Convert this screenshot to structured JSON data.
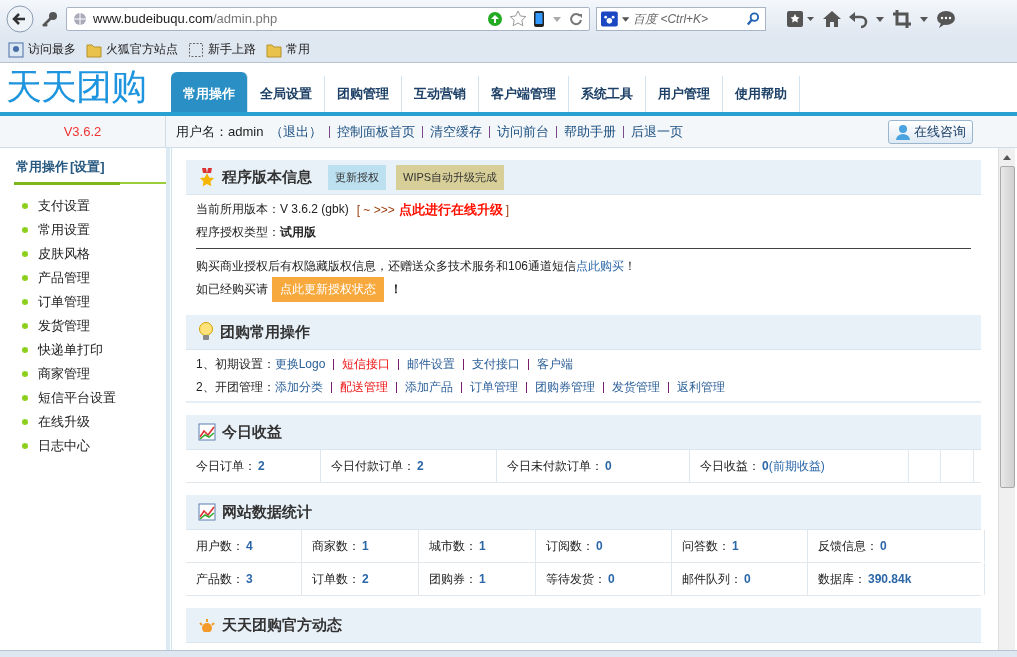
{
  "browser": {
    "url_host": "www.budeibuqu.com",
    "url_path": "/admin.php",
    "search_placeholder": "百度 <Ctrl+K>",
    "bookmarks": [
      {
        "label": "访问最多",
        "kind": "special"
      },
      {
        "label": "火狐官方站点",
        "kind": "folder"
      },
      {
        "label": "新手上路",
        "kind": "page"
      },
      {
        "label": "常用",
        "kind": "folder"
      }
    ]
  },
  "header": {
    "logo": "天天团购",
    "tabs": [
      {
        "label": "常用操作",
        "selected": true
      },
      {
        "label": "全局设置",
        "selected": false
      },
      {
        "label": "团购管理",
        "selected": false
      },
      {
        "label": "互动营销",
        "selected": false
      },
      {
        "label": "客户端管理",
        "selected": false
      },
      {
        "label": "系统工具",
        "selected": false
      },
      {
        "label": "用户管理",
        "selected": false
      },
      {
        "label": "使用帮助",
        "selected": false
      }
    ]
  },
  "subbar": {
    "version": "V3.6.2",
    "user_label": "用户名：",
    "username": "admin",
    "logout": "（退出）",
    "links": [
      "控制面板首页",
      "清空缓存",
      "访问前台",
      "帮助手册",
      "后退一页"
    ],
    "consult_button": "在线咨询"
  },
  "sidebar": {
    "title": "常用操作",
    "title_link": "[设置]",
    "items": [
      "支付设置",
      "常用设置",
      "皮肤风格",
      "产品管理",
      "订单管理",
      "发货管理",
      "快递单打印",
      "商家管理",
      "短信平台设置",
      "在线升级",
      "日志中心"
    ]
  },
  "version_panel": {
    "title": "程序版本信息",
    "buttons": [
      {
        "label": "更新授权",
        "kind": "blue"
      },
      {
        "label": "WIPS自动升级完成",
        "kind": "tan"
      }
    ],
    "current_label": "当前所用版本：",
    "current_value": "V 3.6.2 (gbk)",
    "upgrade_prefix": "[ ~ >>>",
    "upgrade_link": "点此进行在线升级",
    "upgrade_suffix": "]",
    "license_label": "程序授权类型：",
    "license_value": "试用版",
    "promo_text": "购买商业授权后有权隐藏版权信息，还赠送众多技术服务和106通道短信",
    "promo_link": "点此购买",
    "promo_end": "！",
    "renew_prefix": "如已经购买请",
    "renew_button": "点此更新授权状态",
    "renew_end": "！"
  },
  "ops_panel": {
    "title": "团购常用操作",
    "rows": [
      {
        "label": "1、初期设置：",
        "links": [
          {
            "label": "更换Logo",
            "highlight": false
          },
          {
            "label": "短信接口",
            "highlight": true
          },
          {
            "label": "邮件设置",
            "highlight": false
          },
          {
            "label": "支付接口",
            "highlight": false
          },
          {
            "label": "客户端",
            "highlight": false
          }
        ]
      },
      {
        "label": "2、开团管理：",
        "links": [
          {
            "label": "添加分类",
            "highlight": false
          },
          {
            "label": "配送管理",
            "highlight": true
          },
          {
            "label": "添加产品",
            "highlight": false
          },
          {
            "label": "订单管理",
            "highlight": false
          },
          {
            "label": "团购券管理",
            "highlight": false
          },
          {
            "label": "发货管理",
            "highlight": false
          },
          {
            "label": "返利管理",
            "highlight": false
          }
        ]
      }
    ]
  },
  "income_panel": {
    "title": "今日收益",
    "stats": [
      {
        "label": "今日订单：",
        "value": "2"
      },
      {
        "label": "今日付款订单：",
        "value": "2"
      },
      {
        "label": "今日未付款订单：",
        "value": "0"
      },
      {
        "label": "今日收益：",
        "value": "0",
        "link": "(前期收益)"
      }
    ]
  },
  "site_panel": {
    "title": "网站数据统计",
    "rows": [
      [
        {
          "label": "用户数：",
          "value": "4"
        },
        {
          "label": "商家数：",
          "value": "1"
        },
        {
          "label": "城市数：",
          "value": "1"
        },
        {
          "label": "订阅数：",
          "value": "0"
        },
        {
          "label": "问答数：",
          "value": "1"
        },
        {
          "label": "反馈信息：",
          "value": "0"
        }
      ],
      [
        {
          "label": "产品数：",
          "value": "3"
        },
        {
          "label": "订单数：",
          "value": "2"
        },
        {
          "label": "团购券：",
          "value": "1"
        },
        {
          "label": "等待发货：",
          "value": "0"
        },
        {
          "label": "邮件队列：",
          "value": "0"
        },
        {
          "label": "数据库：",
          "value": "390.84k"
        }
      ]
    ]
  },
  "news_panel": {
    "title": "天天团购官方动态"
  }
}
